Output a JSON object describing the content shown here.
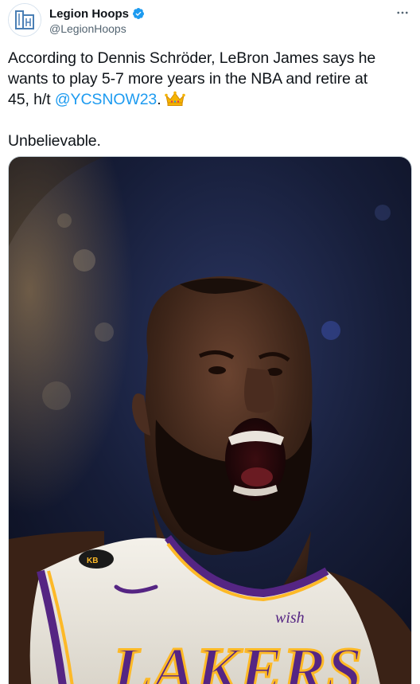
{
  "author": {
    "display_name": "Legion Hoops",
    "handle": "@LegionHoops",
    "verified": true,
    "verified_icon": "verified-badge-icon",
    "avatar_icon": "legion-hoops-logo-avatar"
  },
  "menu": {
    "icon": "more-horizontal-icon"
  },
  "tweet": {
    "line1": "According to Dennis Schröder, LeBron James says he",
    "line2": "wants to play 5-7 more years in the NBA and retire at",
    "line3_prefix": "45, h/t",
    "mention": "@YCSNOW23",
    "line3_suffix": ".",
    "emoji": "crown-emoji",
    "line4": "Unbelievable."
  },
  "media": {
    "type": "photo",
    "jersey_text": "LAKERS",
    "sponsor_text": "wish",
    "colors": {
      "jersey": "#f2f0ea",
      "purple": "#552583",
      "gold": "#fdb927",
      "background": "#141a30"
    }
  },
  "colors": {
    "text": "#0f1419",
    "secondary": "#536471",
    "link": "#1d9bf0",
    "border": "#cfd9de"
  }
}
